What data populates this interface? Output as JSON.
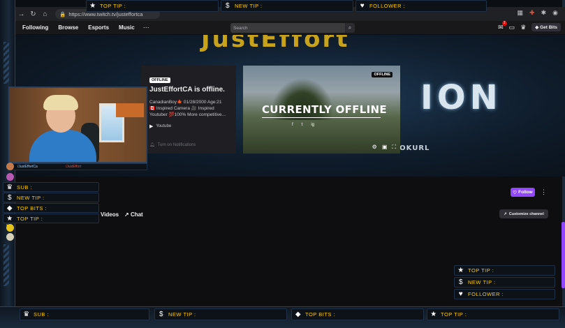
{
  "overlay_top": [
    {
      "icon": "star",
      "label": "TOP TIP :"
    },
    {
      "icon": "dollar",
      "label": "NEW TIP :"
    },
    {
      "icon": "heart",
      "label": "FOLLOWER :"
    }
  ],
  "browser": {
    "url": "https://www.twitch.tv/justeffortca"
  },
  "twitch_nav": {
    "links": [
      "Following",
      "Browse",
      "Esports",
      "Music"
    ],
    "more": "⋯",
    "search_placeholder": "Search",
    "notification_count": "2",
    "get_bits": "Get Bits"
  },
  "banner": {
    "name_text": "JustEffort",
    "big_text": "ION",
    "small_text": "BOOKURL"
  },
  "offline_card": {
    "badge": "OFFLINE",
    "title": "JustEffortCA is offline.",
    "description": "CanadianBoy🍁 01/28/2000 Age:21 🇨🇦 Inspired Camera 🎥 Inspired Youtuber 💯100% More competitive...",
    "youtube_label": "Youtube",
    "notifications_label": "Turn on Notifications"
  },
  "offline_video": {
    "badge": "OFFLINE",
    "headline": "CURRENTLY OFFLINE",
    "socials": [
      "f",
      "t",
      "ig"
    ]
  },
  "cam_footer": {
    "twitter": "/JustEffortCa",
    "youtube": "/JustEffort"
  },
  "overlay_left": [
    {
      "icon": "crown",
      "label": "SUB :"
    },
    {
      "icon": "dollar",
      "label": "NEW TIP :"
    },
    {
      "icon": "bits",
      "label": "TOP BITS :"
    },
    {
      "icon": "star",
      "label": "TOP TIP :"
    }
  ],
  "channel": {
    "follow_label": "Follow",
    "tabs": [
      "Videos",
      "Chat"
    ],
    "customize_label": "Customize channel"
  },
  "overlay_right": [
    {
      "icon": "star",
      "label": "TOP TIP :"
    },
    {
      "icon": "dollar",
      "label": "NEW TIP :"
    },
    {
      "icon": "heart",
      "label": "FOLLOWER :"
    }
  ],
  "overlay_bottom": [
    {
      "icon": "crown",
      "label": "SUB :"
    },
    {
      "icon": "dollar",
      "label": "NEW TIP :"
    },
    {
      "icon": "bits",
      "label": "TOP BITS :"
    },
    {
      "icon": "star",
      "label": "TOP TIP :"
    }
  ],
  "colors": {
    "overlay_text": "#ffcc00",
    "twitch_purple": "#9147ff",
    "frame_blue": "#2b4360"
  }
}
